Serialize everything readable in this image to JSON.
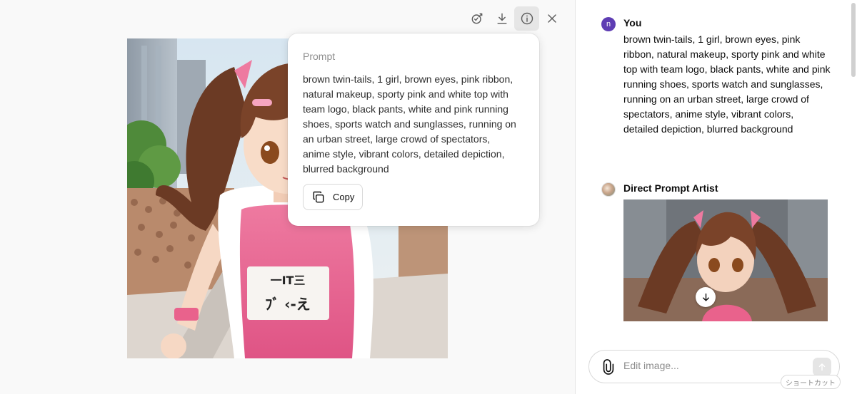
{
  "viewer": {
    "toolbar": {
      "icons": [
        "edit-image-icon",
        "download-icon",
        "info-icon",
        "close-icon"
      ]
    },
    "image": {
      "bib_text_top": "一IT三",
      "bib_text_bottom": "ﾌﾞ ‹-え"
    },
    "popover": {
      "title": "Prompt",
      "text": "brown twin-tails, 1 girl, brown eyes, pink ribbon, natural makeup, sporty pink and white top with team logo, black pants, white and pink running shoes, sports watch and sunglasses, running on an urban street, large crowd of spectators, anime style, vibrant colors, detailed depiction, blurred background",
      "copy_label": "Copy"
    }
  },
  "chat": {
    "user": {
      "avatar_letter": "n",
      "name": "You",
      "message": "brown twin-tails, 1 girl, brown eyes, pink ribbon, natural makeup, sporty pink and white top with team logo, black pants, white and pink running shoes, sports watch and sunglasses, running on an urban street, large crowd of spectators, anime style, vibrant colors, detailed depiction, blurred background"
    },
    "assistant": {
      "name": "Direct Prompt Artist"
    },
    "composer": {
      "placeholder": "Edit image...",
      "shortcut_label": "ショートカット"
    }
  },
  "colors": {
    "accent_avatar": "#5e3db3",
    "shirt_pink": "#e9628c",
    "hair_brown": "#6b3a24"
  }
}
